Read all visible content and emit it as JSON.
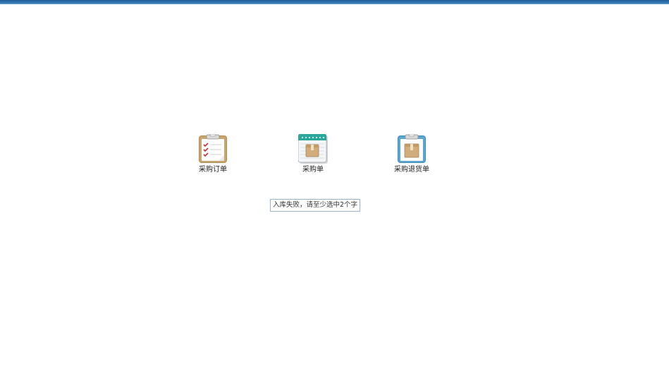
{
  "colors": {
    "topbar": "#2f77b3",
    "tooltip_border": "#9cb3cc",
    "clipboard_frame": "#b08f56",
    "return_frame": "#3f8fbd",
    "notebook_header": "#2aa79a"
  },
  "shortcuts": [
    {
      "label": "采购订单",
      "icon": "clipboard-checklist-icon"
    },
    {
      "label": "采购单",
      "icon": "notebook-box-icon"
    },
    {
      "label": "采购退货单",
      "icon": "clipboard-box-icon"
    }
  ],
  "tooltip": {
    "text": "入库失败，请至少选中2个字"
  }
}
